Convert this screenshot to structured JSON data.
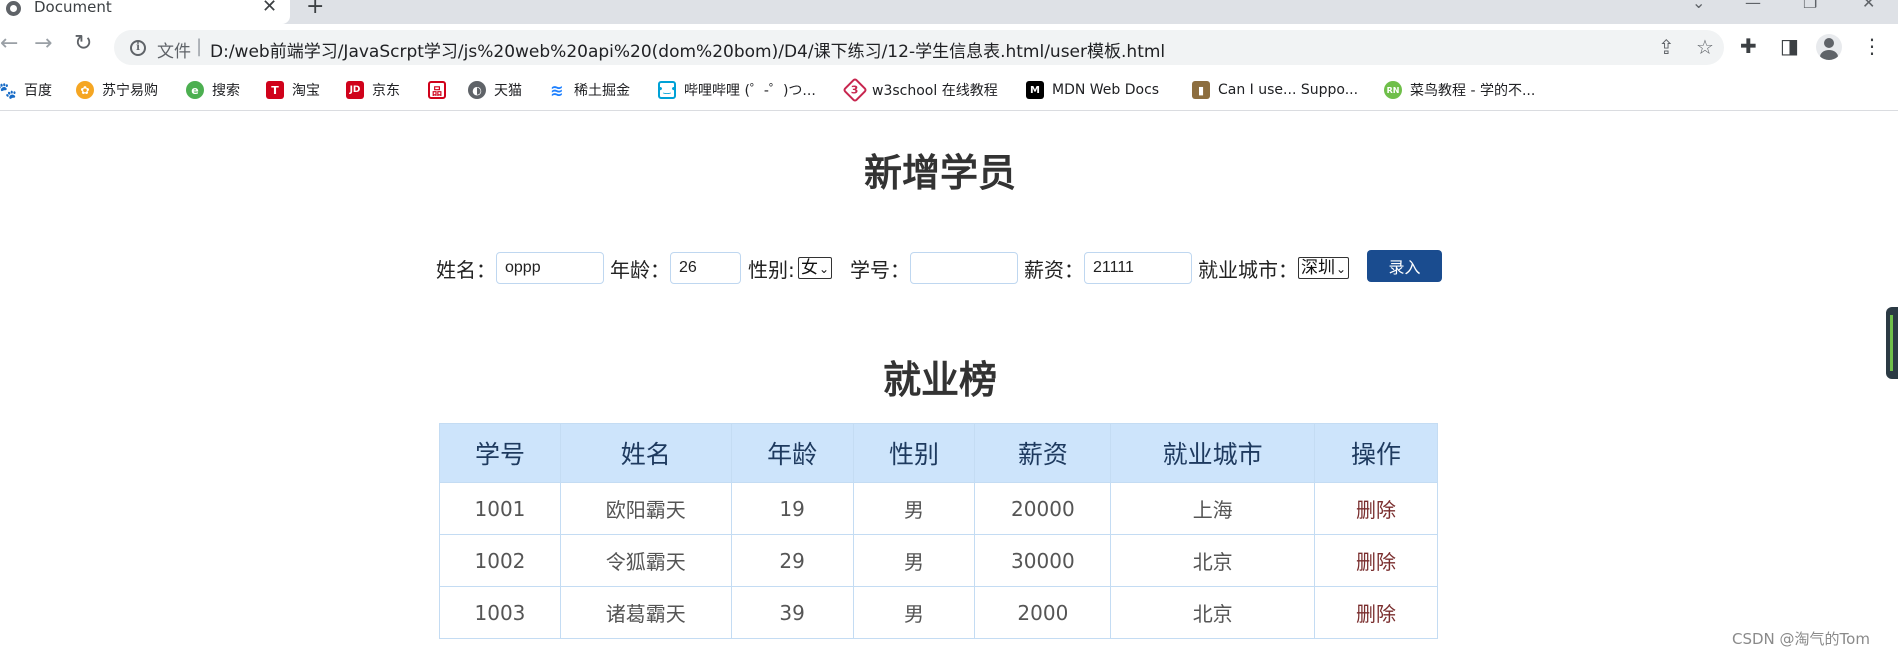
{
  "browser": {
    "tab_title": "Document",
    "file_label": "文件",
    "url": "D:/web前端学习/JavaScrpt学习/js%20web%20api%20(dom%20bom)/D4/课下练习/12-学生信息表.html/user模板.html"
  },
  "bookmarks": [
    {
      "label": "百度",
      "icon": "baidu-icon",
      "color": "#2932e1"
    },
    {
      "label": "苏宁易购",
      "icon": "suning-icon",
      "color": "#f5a623"
    },
    {
      "label": "搜索",
      "icon": "search-engine-icon",
      "color": "#4caf50"
    },
    {
      "label": "淘宝",
      "icon": "taobao-icon",
      "color": "#d0021b"
    },
    {
      "label": "京东",
      "icon": "jd-icon",
      "color": "#d0021b"
    },
    {
      "label": "",
      "icon": "grid-logo-icon",
      "color": "#d0021b"
    },
    {
      "label": "天猫",
      "icon": "globe-icon",
      "color": "#5f6368"
    },
    {
      "label": "稀土掘金",
      "icon": "juejin-icon",
      "color": "#1e80ff"
    },
    {
      "label": "哔哩哔哩 (゜-゜)つ...",
      "icon": "bilibili-icon",
      "color": "#00a1d6"
    },
    {
      "label": "w3school 在线教程",
      "icon": "w3school-icon",
      "color": "#c7254e"
    },
    {
      "label": "MDN Web Docs",
      "icon": "mdn-icon",
      "color": "#000000"
    },
    {
      "label": "Can I use... Suppo...",
      "icon": "caniuse-icon",
      "color": "#8d6e3f"
    },
    {
      "label": "菜鸟教程 - 学的不...",
      "icon": "runoob-icon",
      "color": "#6fbf4a"
    }
  ],
  "form": {
    "title": "新增学员",
    "name_label": "姓名：",
    "name_value": "oppp",
    "age_label": "年龄：",
    "age_value": "26",
    "gender_label": "性别:",
    "gender_value": "女",
    "id_label": "学号：",
    "id_value": "",
    "salary_label": "薪资：",
    "salary_value": "21111",
    "city_label": "就业城市：",
    "city_value": "深圳",
    "submit_label": "录入"
  },
  "table": {
    "title": "就业榜",
    "headers": [
      "学号",
      "姓名",
      "年龄",
      "性别",
      "薪资",
      "就业城市",
      "操作"
    ],
    "rows": [
      [
        "1001",
        "欧阳霸天",
        "19",
        "男",
        "20000",
        "上海",
        "删除"
      ],
      [
        "1002",
        "令狐霸天",
        "29",
        "男",
        "30000",
        "北京",
        "删除"
      ],
      [
        "1003",
        "诸葛霸天",
        "39",
        "男",
        "2000",
        "北京",
        "删除"
      ]
    ]
  },
  "watermark": "CSDN @淘气的Tom",
  "colors": {
    "header_bg": "#cde4fb",
    "border": "#c4dcf3",
    "button": "#1a4c8f"
  }
}
